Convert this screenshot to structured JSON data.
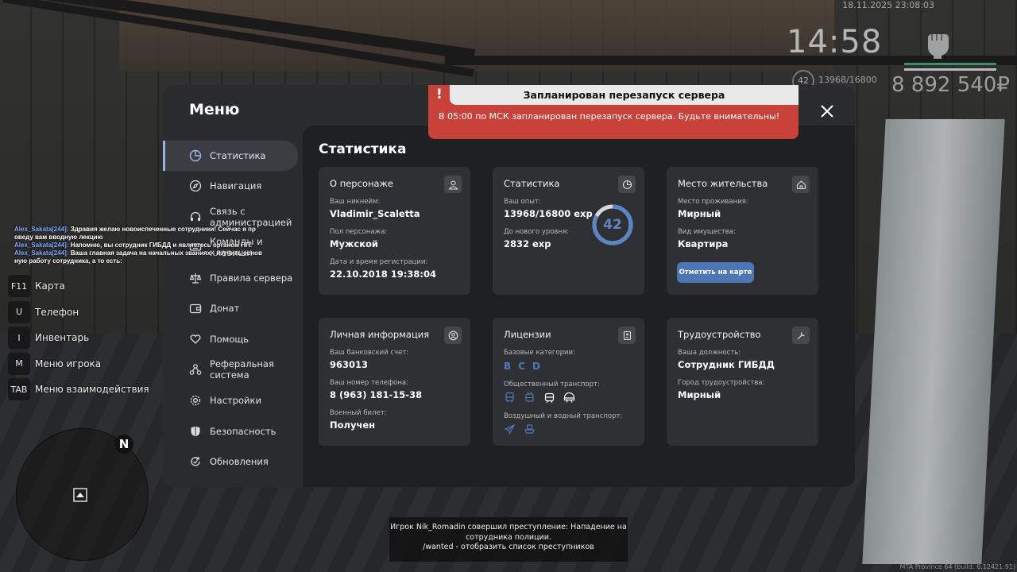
{
  "hud": {
    "datetime": "18.11.2025 23:08:03",
    "time": "14:58",
    "level": "42",
    "exp": "13968/16800",
    "money": "8 892 540₽"
  },
  "chat": [
    {
      "nick": "Alex_Sakata[244]:",
      "text": " Здравия желаю новоиспеченные сотрудники! Сейчас я пр оведу вам вводную лекцию"
    },
    {
      "nick": "Alex_Sakata[244]:",
      "text": " Напомню, вы сотрудник ГИБДД и являетесь органом ПП."
    },
    {
      "nick": "Alex_Sakata[244]:",
      "text": " Ваша главная задача на начальных званиях - изучить основ ную работу сотрудника, а то есть:"
    }
  ],
  "hotkeys": [
    {
      "key": "F11",
      "label": "Карта"
    },
    {
      "key": "U",
      "label": "Телефон"
    },
    {
      "key": "I",
      "label": "Инвентарь"
    },
    {
      "key": "M",
      "label": "Меню игрока"
    },
    {
      "key": "TAB",
      "label": "Меню взаимодействия"
    }
  ],
  "minimap": {
    "compass": "N"
  },
  "menu": {
    "title": "Меню",
    "nav": [
      {
        "label": "Статистика",
        "icon": "pie-chart-icon"
      },
      {
        "label": "Навигация",
        "icon": "compass-icon"
      },
      {
        "label": "Связь с администрацией",
        "icon": "headset-icon"
      },
      {
        "label": "Команды и клавиши",
        "icon": "keyboard-icon"
      },
      {
        "label": "Правила сервера",
        "icon": "scales-icon"
      },
      {
        "label": "Донат",
        "icon": "wallet-icon"
      },
      {
        "label": "Помощь",
        "icon": "heart-hand-icon"
      },
      {
        "label": "Реферальная система",
        "icon": "network-icon"
      },
      {
        "label": "Настройки",
        "icon": "gear-icon"
      },
      {
        "label": "Безопасность",
        "icon": "shield-icon"
      },
      {
        "label": "Обновления",
        "icon": "refresh-icon"
      }
    ],
    "content_title": "Статистика",
    "cards": {
      "character": {
        "title": "О персонаже",
        "nick_label": "Ваш никнейм:",
        "nick": "Vladimir_Scaletta",
        "gender_label": "Пол персонажа:",
        "gender": "Мужской",
        "reg_label": "Дата и время регистрации:",
        "reg": "22.10.2018 19:38:04"
      },
      "stats": {
        "title": "Статистика",
        "exp_label": "Ваш опыт:",
        "exp": "13968/16800 exp",
        "next_label": "До нового уровня:",
        "next": "2832 exp",
        "level": "42",
        "level_progress": 0.83
      },
      "residence": {
        "title": "Место жительства",
        "place_label": "Место проживания:",
        "place": "Мирный",
        "property_label": "Вид имущества:",
        "property": "Квартира",
        "button": "Отметить на карте"
      },
      "personal": {
        "title": "Личная информация",
        "bank_label": "Ваш банковский счет:",
        "bank": "963013",
        "phone_label": "Ваш номер телефона:",
        "phone": "8 (963) 181-15-38",
        "military_label": "Военный билет:",
        "military": "Получен"
      },
      "licenses": {
        "title": "Лицензии",
        "base_label": "Базовые категории:",
        "base": [
          "B",
          "C",
          "D"
        ],
        "public_label": "Общественный транспорт:",
        "public_icons": [
          "bus-icon",
          "trolleybus-icon",
          "tram-icon",
          "metro-icon"
        ],
        "air_label": "Воздушный и водный транспорт:",
        "air_icons": [
          "plane-icon",
          "boat-icon"
        ]
      },
      "employment": {
        "title": "Трудоустройство",
        "position_label": "Ваша должность:",
        "position": "Сотрудник ГИБДД",
        "city_label": "Город трудоустройства:",
        "city": "Мирный"
      }
    }
  },
  "alert": {
    "title": "Запланирован перезапуск сервера",
    "message": "В 05:00 по МСК запланирован перезапуск сервера. Будьте внимательны!",
    "mark": "!"
  },
  "notice": {
    "line1": "Игрок Nik_Romadin совершил преступление: Нападение на сотрудника полиции.",
    "line2": "/wanted - отобразить список преступников"
  },
  "build": "MTA Province 64 (build: 6.12421.91)",
  "colors": {
    "accent": "#4d77b4",
    "alert": "#c9423a",
    "panel": "#2a2b2d"
  }
}
